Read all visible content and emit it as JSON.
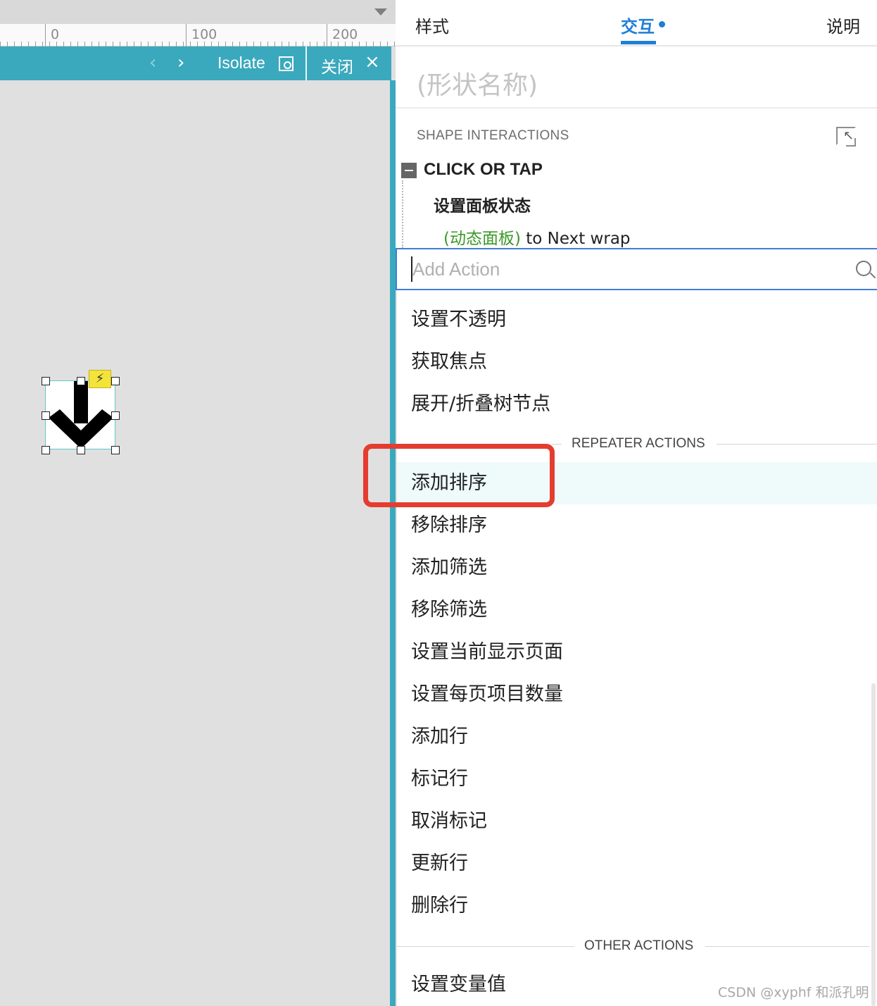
{
  "ruler": {
    "labels": [
      "0",
      "100",
      "200"
    ]
  },
  "isolate_bar": {
    "prev": "‹",
    "next": "›",
    "isolate_label": "Isolate",
    "close_label": "关闭",
    "close_icon": "×"
  },
  "shape": {
    "badge": "⚡"
  },
  "panel": {
    "tabs": {
      "style": "样式",
      "interactions": "交互",
      "notes": "说明"
    },
    "shape_name": "(形状名称)",
    "shape_interactions_heading": "SHAPE INTERACTIONS",
    "event": "CLICK OR TAP",
    "action": "设置面板状态",
    "action_target": "(动态面板)",
    "action_detail": " to Next wrap",
    "search": {
      "placeholder": "Add Action",
      "value": ""
    },
    "menu": {
      "widget_actions": [
        "设置不透明",
        "获取焦点",
        "展开/折叠树节点"
      ],
      "repeater_heading": "REPEATER ACTIONS",
      "repeater_actions": [
        "添加排序",
        "移除排序",
        "添加筛选",
        "移除筛选",
        "设置当前显示页面",
        "设置每页项目数量",
        "添加行",
        "标记行",
        "取消标记",
        "更新行",
        "删除行"
      ],
      "other_heading": "OTHER ACTIONS",
      "other_actions": [
        "设置变量值"
      ],
      "hovered_item": "添加排序"
    }
  },
  "watermark": "CSDN @xyphf 和派孔明",
  "colors": {
    "accent": "#3aa9bd",
    "tab_active": "#1e7ed8",
    "target_green": "#3a9a28",
    "highlight": "#e43d2f",
    "hover_row": "#effafb"
  }
}
